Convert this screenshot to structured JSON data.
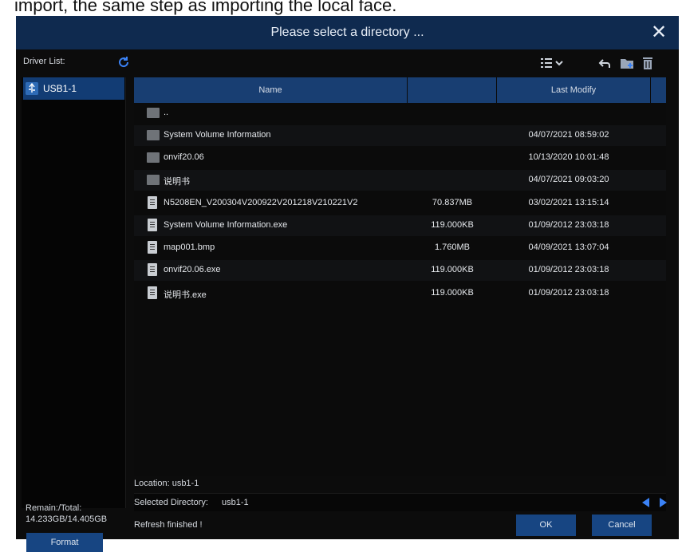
{
  "page_text": "import, the same step as importing the local face.",
  "dialog": {
    "title": "Please select a directory ...",
    "close_glyph": "✕"
  },
  "sidebar": {
    "driver_list_label": "Driver List:",
    "drives": [
      {
        "label": "USB1-1",
        "icon": "usb-drive-icon"
      }
    ],
    "remain_label": "Remain:/Total:",
    "remain_value": "14.233GB/14.405GB",
    "format_label": "Format"
  },
  "table": {
    "columns": [
      "Name",
      "",
      "Last Modify"
    ],
    "rows": [
      {
        "type": "folder",
        "name": "..",
        "size": "",
        "modified": ""
      },
      {
        "type": "folder",
        "name": "System Volume Information",
        "size": "",
        "modified": "04/07/2021 08:59:02"
      },
      {
        "type": "folder",
        "name": "onvif20.06",
        "size": "",
        "modified": "10/13/2020 10:01:48"
      },
      {
        "type": "folder",
        "name": "说明书",
        "size": "",
        "modified": "04/07/2021 09:03:20"
      },
      {
        "type": "file",
        "name": "N5208EN_V200304V200922V201218V210221V2",
        "size": "70.837MB",
        "modified": "03/02/2021 13:15:14"
      },
      {
        "type": "file",
        "name": "System Volume Information.exe",
        "size": "119.000KB",
        "modified": "01/09/2012 23:03:18"
      },
      {
        "type": "file",
        "name": "map001.bmp",
        "size": "1.760MB",
        "modified": "04/09/2021 13:07:04"
      },
      {
        "type": "file",
        "name": "onvif20.06.exe",
        "size": "119.000KB",
        "modified": "01/09/2012 23:03:18"
      },
      {
        "type": "file",
        "name": "说明书.exe",
        "size": "119.000KB",
        "modified": "01/09/2012 23:03:18"
      }
    ]
  },
  "footer": {
    "location": "Location: usb1-1",
    "selected_label": "Selected Directory:",
    "selected_value": "usb1-1",
    "status": "Refresh finished !",
    "ok_label": "OK",
    "cancel_label": "Cancel"
  },
  "colors": {
    "titlebar": "#0f2a4f",
    "header": "#183e72",
    "button": "#174582",
    "accent": "#3b82f6"
  }
}
